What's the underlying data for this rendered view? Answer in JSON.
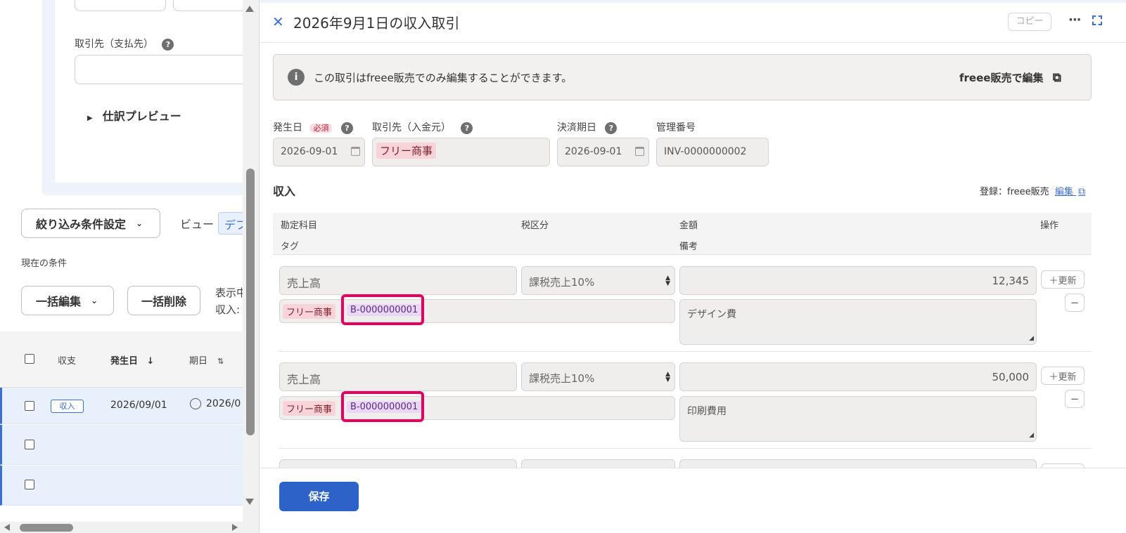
{
  "left_panel": {
    "partner_label": "取引先（支払先）",
    "journal_preview": "仕訳プレビュー",
    "filter_button": "絞り込み条件設定",
    "view_label": "ビュー",
    "view_value": "デフ",
    "current_conditions": "現在の条件",
    "bulk_edit": "一括編集",
    "bulk_delete": "一括削除",
    "display_label": "表示中",
    "income_label": "収入:",
    "table_headers": {
      "type": "収支",
      "date": "発生日",
      "due": "期日"
    },
    "rows": [
      {
        "type": "収入",
        "date": "2026/09/01",
        "due": "2026/0"
      }
    ]
  },
  "drawer": {
    "title": "2026年9月1日の収入取引",
    "copy_button": "コピー",
    "notice": {
      "text": "この取引はfreee販売でのみ編集することができます。",
      "link": "freee販売で編集"
    },
    "fields": {
      "date_label": "発生日",
      "required_badge": "必須",
      "date_value": "2026-09-01",
      "partner_label": "取引先（入金元）",
      "partner_value": "フリー商事",
      "due_label": "決済期日",
      "due_value": "2026-09-01",
      "mgmt_label": "管理番号",
      "mgmt_value": "INV-0000000002"
    },
    "section": {
      "title": "収入",
      "registered_by": "登録：freee販売",
      "edit_link": "編集"
    },
    "table_header": {
      "account": "勘定科目",
      "tax": "税区分",
      "amount": "金額",
      "action": "操作",
      "tag": "タグ",
      "memo": "備考"
    },
    "lines": [
      {
        "account": "売上高",
        "tax": "課税売上10%",
        "amount": "12,345",
        "partner_tag": "フリー商事",
        "number_tag": "B-0000000001",
        "memo": "デザイン費",
        "update": "＋更新"
      },
      {
        "account": "売上高",
        "tax": "課税売上10%",
        "amount": "50,000",
        "partner_tag": "フリー商事",
        "number_tag": "B-0000000001",
        "memo": "印刷費用",
        "update": "＋更新"
      }
    ],
    "save_button": "保存"
  },
  "colors": {
    "accent": "#3c6fd4",
    "highlight": "#e6005c",
    "tag_red_bg": "#f8d3d8",
    "tag_purple_bg": "#ead6f5"
  }
}
